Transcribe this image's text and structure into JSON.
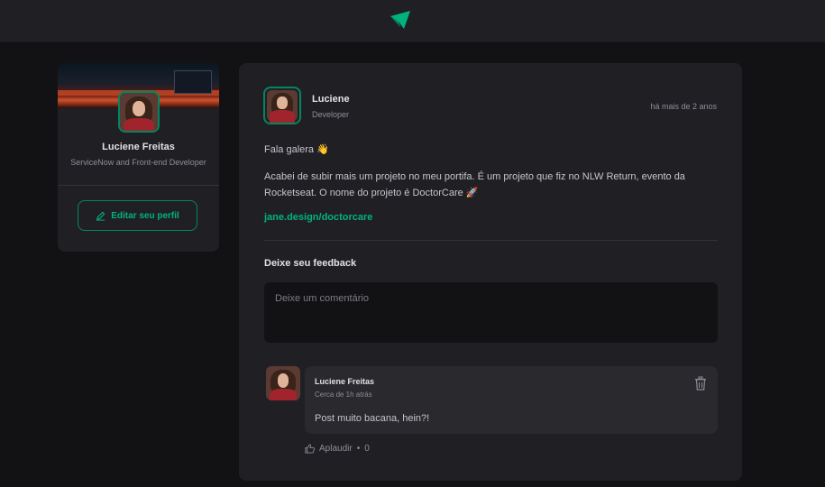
{
  "header": {
    "logo_icon": "paper-plane-icon"
  },
  "sidebar": {
    "name": "Luciene Freitas",
    "role": "ServiceNow and Front-end Developer",
    "edit_button_label": "Editar seu perfil"
  },
  "post": {
    "author_name": "Luciene",
    "author_role": "Developer",
    "time": "há mais de 2 anos",
    "content_line1": "Fala galera 👋",
    "content_line2": "Acabei de subir mais um projeto no meu portifa. É um projeto que fiz no NLW Return, evento da Rocketseat. O nome do projeto é DoctorCare 🚀",
    "link": "jane.design/doctorcare",
    "feedback_title": "Deixe seu feedback",
    "comment_placeholder": "Deixe um comentário"
  },
  "comment": {
    "author": "Luciene Freitas",
    "time": "Cerca de 1h atrás",
    "text": "Post muito bacana, hein?!",
    "applaud_label": "Aplaudir",
    "applaud_separator": "•",
    "applaud_count": "0"
  },
  "colors": {
    "accent": "#00b37e",
    "accent_dark": "#00875f",
    "background": "#121214",
    "card": "#202024"
  }
}
